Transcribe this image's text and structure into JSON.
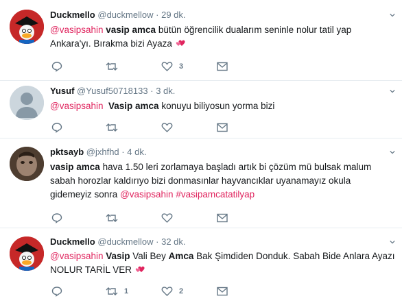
{
  "tweets": [
    {
      "name": "Duckmello",
      "handle": "@duckmellow",
      "sep": "·",
      "time": "29 dk.",
      "line1": {
        "mention": "@vasipsahin",
        "bold": "vasip amca",
        "text": " bütün öğrencilik dualarım seninle nolur tatil yap"
      },
      "line2": "Ankara'yı. Bırakma bizi Ayaza",
      "reply_count": "",
      "retweet_count": "",
      "like_count": "3",
      "emoji": "two-hearts-icon"
    },
    {
      "name": "Yusuf",
      "handle": "@Yusuf50718133",
      "sep": "·",
      "time": "3 dk.",
      "line1": {
        "mention": "@vasipsahin",
        "bold": "Vasip amca",
        "text": " konuyu biliyosun yorma bizi"
      },
      "reply_count": "",
      "retweet_count": "",
      "like_count": ""
    },
    {
      "name": "pktsayb",
      "handle": "@jxhfhd",
      "sep": "·",
      "time": "4 dk.",
      "line1": {
        "bold": "vasip amca",
        "text": " hava 1.50 leri zorlamaya başladı artık bi çözüm mü bulsak malum"
      },
      "line2": "sabah horozlar kaldırıyo bizi donmasınlar hayvancıklar uyanamayız okula",
      "line3": {
        "text": "gidemeyiz sonra ",
        "mention": "@vasipsahin",
        "hashtag": "#vasipamcatatilyap"
      },
      "reply_count": "",
      "retweet_count": "",
      "like_count": ""
    },
    {
      "name": "Duckmello",
      "handle": "@duckmellow",
      "sep": "·",
      "time": "32 dk.",
      "line1": {
        "mention": "@vasipsahin",
        "bold1": "Vasip",
        "text1": " Vali Bey ",
        "bold2": "Amca",
        "text2": " Bak Şimdiden Donduk. Sabah Bide Anlara Ayazı"
      },
      "line2": "NOLUR TARİL VER",
      "reply_count": "",
      "retweet_count": "1",
      "like_count": "2",
      "emoji": "two-hearts-icon"
    }
  ],
  "colors": {
    "mention": "#e0245e",
    "muted": "#657786",
    "text": "#14171a",
    "divider": "#e6ecf0"
  }
}
